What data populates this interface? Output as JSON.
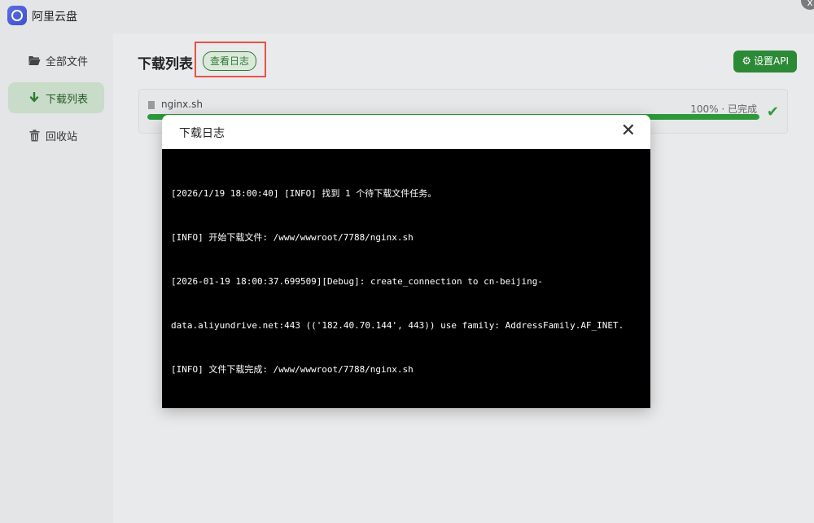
{
  "app": {
    "title": "阿里云盘",
    "close_glyph": "x"
  },
  "sidebar": {
    "items": [
      {
        "label": "全部文件",
        "icon": "folder-open-icon",
        "active": false
      },
      {
        "label": "下载列表",
        "icon": "arrow-down-icon",
        "active": true
      },
      {
        "label": "回收站",
        "icon": "trash-icon",
        "active": false
      }
    ]
  },
  "main": {
    "title": "下载列表",
    "log_button": "查看日志",
    "api_button": "设置API",
    "downloads": [
      {
        "file": "nginx.sh",
        "status": "100% · 已完成",
        "progress": 100
      }
    ]
  },
  "dialog": {
    "title": "下载日志",
    "close_glyph": "✕",
    "lines": [
      "[2026/1/19 18:00:40] [INFO] 找到 1 个待下载文件任务。",
      "[INFO] 开始下载文件: /www/wwwroot/7788/nginx.sh",
      "[2026-01-19 18:00:37.699509][Debug]: create_connection to cn-beijing-",
      "data.aliyundrive.net:443 (('182.40.70.144', 443)) use family: AddressFamily.AF_INET.",
      "[INFO] 文件下载完成: /www/wwwroot/7788/nginx.sh"
    ]
  },
  "colors": {
    "accent": "#2c8a36",
    "highlight": "#e6534a"
  }
}
